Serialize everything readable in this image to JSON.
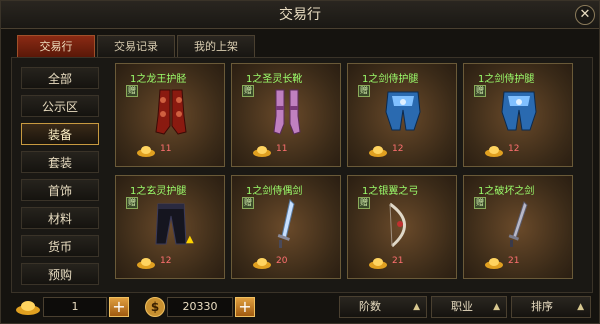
{
  "title": "交易行",
  "close_label": "✕",
  "tabs": [
    {
      "label": "交易行"
    },
    {
      "label": "交易记录"
    },
    {
      "label": "我的上架"
    }
  ],
  "sidebar": [
    {
      "label": "全部"
    },
    {
      "label": "公示区"
    },
    {
      "label": "装备"
    },
    {
      "label": "套装"
    },
    {
      "label": "首饰"
    },
    {
      "label": "材料"
    },
    {
      "label": "货币"
    },
    {
      "label": "预购"
    }
  ],
  "items": [
    {
      "name": "1之龙王护胫",
      "badge": "赠",
      "price": "11",
      "art": "red-leggings-icon"
    },
    {
      "name": "1之圣灵长靴",
      "badge": "赠",
      "price": "11",
      "art": "pink-boots-icon"
    },
    {
      "name": "1之剑侍护腿",
      "badge": "赠",
      "price": "12",
      "art": "blue-leggings-icon"
    },
    {
      "name": "1之剑侍护腿",
      "badge": "赠",
      "price": "12",
      "art": "blue-leggings-icon"
    },
    {
      "name": "1之玄灵护腿",
      "badge": "赠",
      "price": "12",
      "art": "black-pants-icon",
      "upgrade": "▲"
    },
    {
      "name": "1之剑侍偶剑",
      "badge": "赠",
      "price": "20",
      "art": "sword-icon"
    },
    {
      "name": "1之银翼之弓",
      "badge": "赠",
      "price": "21",
      "art": "bow-icon"
    },
    {
      "name": "1之破坏之剑",
      "badge": "赠",
      "price": "21",
      "art": "dagger-icon"
    }
  ],
  "bottom": {
    "quantity": "1",
    "plus": "+",
    "currency": "20330",
    "currency_symbol": "$",
    "sort_buttons": [
      {
        "label": "阶数",
        "arrow": "▲"
      },
      {
        "label": "职业",
        "arrow": "▲"
      },
      {
        "label": "排序",
        "arrow": "▲"
      }
    ]
  },
  "colors": {
    "item_name": "#9cff6c",
    "price": "#ff7070",
    "tab_active": "#8a2a14",
    "sidebar_active_border": "#c89a40"
  }
}
